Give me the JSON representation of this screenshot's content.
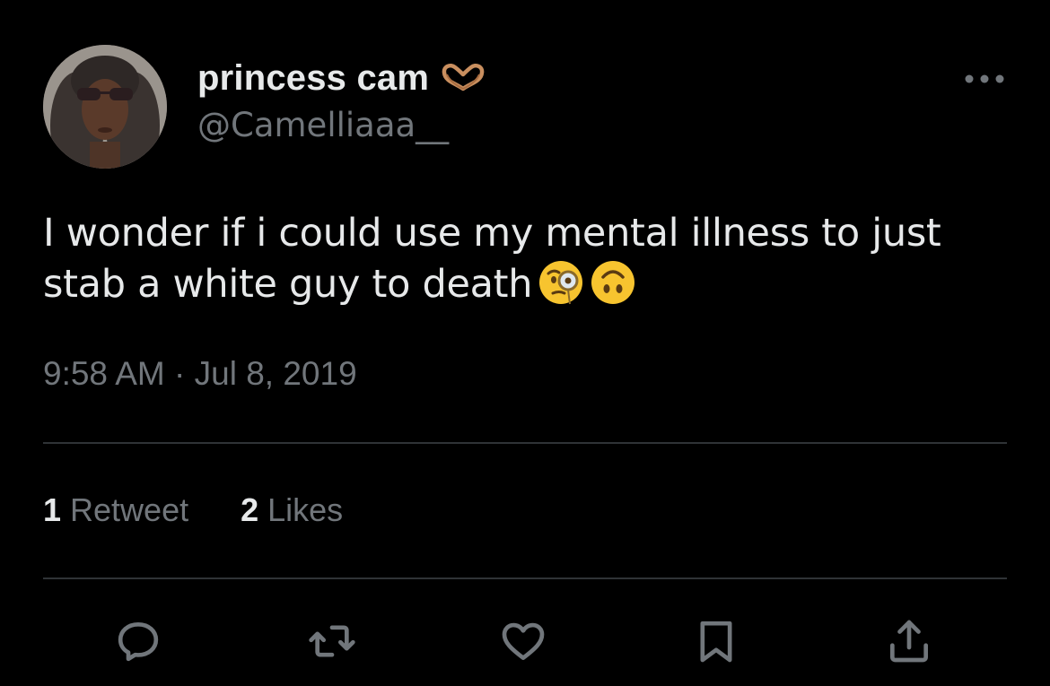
{
  "tweet": {
    "display_name": "princess cam",
    "name_emoji": "heart-hands-icon",
    "handle": "@Camelliaaa__",
    "text": "I wonder if i could use my mental illness to just stab a white guy to death",
    "text_emojis": [
      "face-with-monocle-icon",
      "upside-down-face-icon"
    ],
    "timestamp": "9:58 AM · Jul 8, 2019",
    "stats": {
      "retweets_count": "1",
      "retweets_label": "Retweet",
      "likes_count": "2",
      "likes_label": "Likes"
    }
  },
  "actions": [
    "reply-icon",
    "retweet-icon",
    "like-icon",
    "bookmark-icon",
    "share-icon"
  ],
  "colors": {
    "background": "#000000",
    "primary_text": "#e7e9ea",
    "secondary_text": "#71767b",
    "divider": "#2f3336",
    "emoji_yellow": "#f7c42f"
  }
}
